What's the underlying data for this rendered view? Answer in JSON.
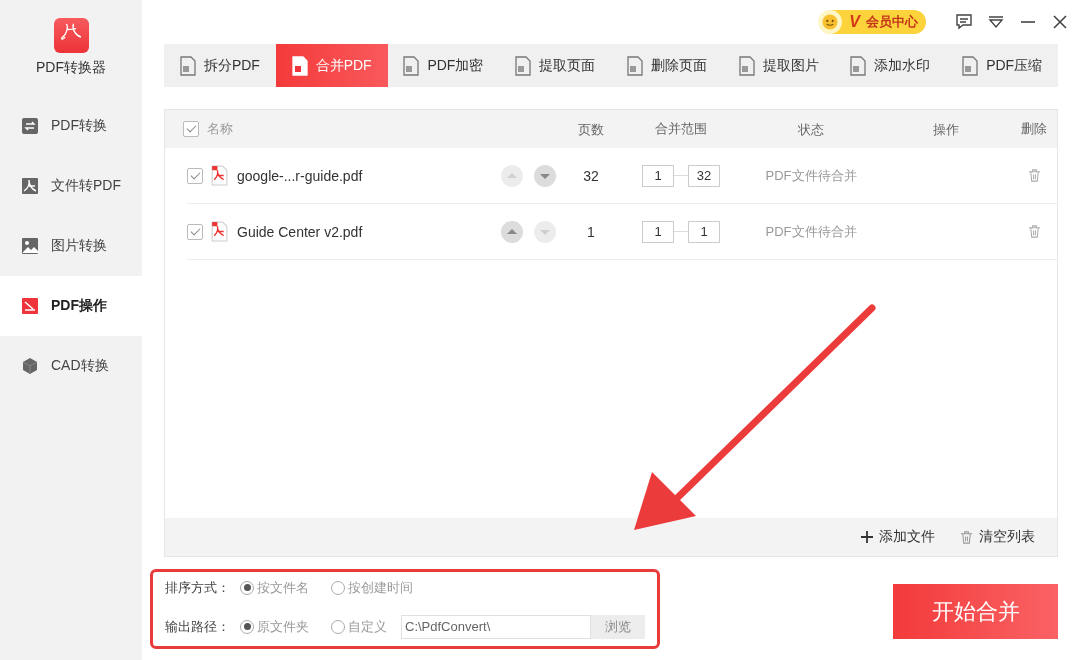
{
  "app": {
    "name": "PDF转换器"
  },
  "sidebar": {
    "items": [
      {
        "label": "PDF转换",
        "selected": false
      },
      {
        "label": "文件转PDF",
        "selected": false
      },
      {
        "label": "图片转换",
        "selected": false
      },
      {
        "label": "PDF操作",
        "selected": true
      },
      {
        "label": "CAD转换",
        "selected": false
      }
    ]
  },
  "vip": {
    "label": "会员中心",
    "mark": "V"
  },
  "tabs": [
    {
      "label": "拆分PDF",
      "selected": false
    },
    {
      "label": "合并PDF",
      "selected": true
    },
    {
      "label": "PDF加密",
      "selected": false
    },
    {
      "label": "提取页面",
      "selected": false
    },
    {
      "label": "删除页面",
      "selected": false
    },
    {
      "label": "提取图片",
      "selected": false
    },
    {
      "label": "添加水印",
      "selected": false
    },
    {
      "label": "PDF压缩",
      "selected": false
    }
  ],
  "table": {
    "select_all_checked": true,
    "columns": [
      "名称",
      "页数",
      "合并范围",
      "状态",
      "操作",
      "删除"
    ],
    "rows": [
      {
        "checked": true,
        "name": "google-...r-guide.pdf",
        "can_move_up": false,
        "can_move_down": true,
        "pages": "32",
        "range_from": "1",
        "range_to": "32",
        "status": "PDF文件待合并"
      },
      {
        "checked": true,
        "name": "Guide Center v2.pdf",
        "can_move_up": true,
        "can_move_down": false,
        "pages": "1",
        "range_from": "1",
        "range_to": "1",
        "status": "PDF文件待合并"
      }
    ],
    "add_label": "添加文件",
    "clear_label": "清空列表"
  },
  "options": {
    "sort_label": "排序方式：",
    "sort_options": [
      {
        "label": "按文件名",
        "selected": true
      },
      {
        "label": "按创建时间",
        "selected": false
      }
    ],
    "output_label": "输出路径：",
    "output_options": [
      {
        "label": "原文件夹",
        "selected": true
      },
      {
        "label": "自定义",
        "selected": false
      }
    ],
    "path": "C:\\PdfConvert\\",
    "browse_label": "浏览",
    "browse_disabled": true
  },
  "start_label": "开始合并"
}
